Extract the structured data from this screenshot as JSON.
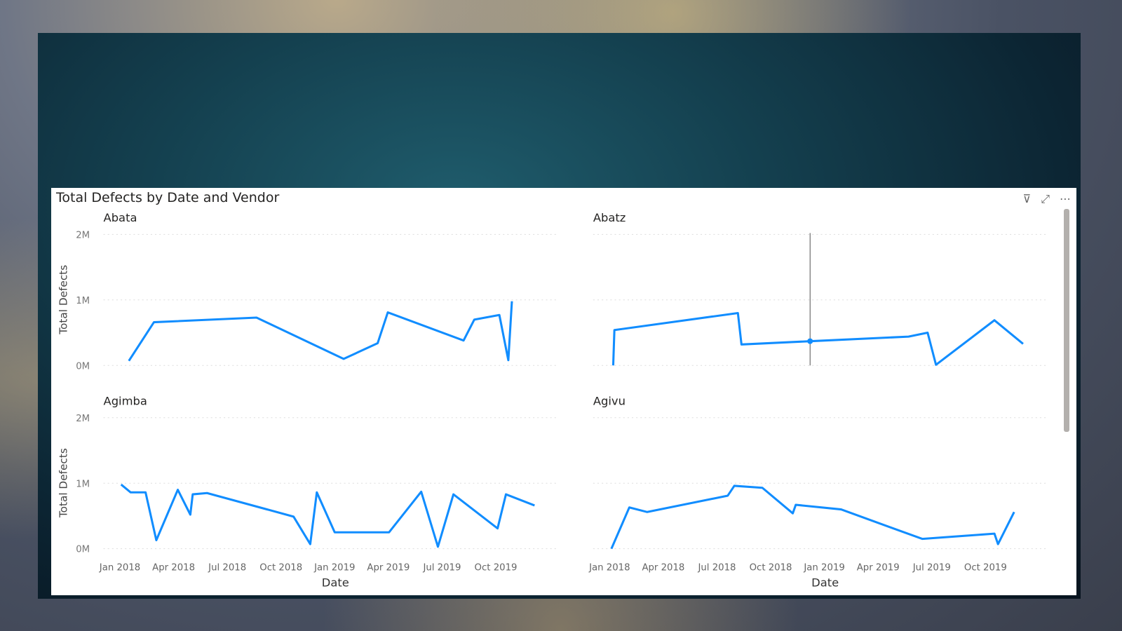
{
  "visual": {
    "title": "Total Defects by Date and Vendor",
    "icons": [
      "filter-icon",
      "focus-mode-icon",
      "more-options-icon"
    ]
  },
  "chart_data": {
    "type": "line",
    "title": "Total Defects by Date and Vendor",
    "xlabel": "Date",
    "ylabel": "Total Defects",
    "line_color": "#118DFF",
    "grid": true,
    "ylim": [
      0,
      2000000
    ],
    "y_ticks": [
      "0M",
      "1M",
      "2M"
    ],
    "x_ticks": [
      "Jan 2018",
      "Apr 2018",
      "Jul 2018",
      "Oct 2018",
      "Jan 2019",
      "Apr 2019",
      "Jul 2019",
      "Oct 2019"
    ],
    "small_multiples": [
      {
        "name": "Abata",
        "points": [
          [
            "2018-01-16",
            70000
          ],
          [
            "2018-02-28",
            660000
          ],
          [
            "2018-08-20",
            730000
          ],
          [
            "2019-01-16",
            100000
          ],
          [
            "2019-03-13",
            340000
          ],
          [
            "2019-03-30",
            810000
          ],
          [
            "2019-08-07",
            380000
          ],
          [
            "2019-08-25",
            700000
          ],
          [
            "2019-10-07",
            770000
          ],
          [
            "2019-10-22",
            80000
          ],
          [
            "2019-10-28",
            980000
          ]
        ]
      },
      {
        "name": "Abatz",
        "hover_date": "2018-12-07",
        "points": [
          [
            "2018-01-07",
            0
          ],
          [
            "2018-01-09",
            540000
          ],
          [
            "2018-08-06",
            800000
          ],
          [
            "2018-08-12",
            320000
          ],
          [
            "2018-12-07",
            370000
          ],
          [
            "2019-05-22",
            440000
          ],
          [
            "2019-06-24",
            500000
          ],
          [
            "2019-07-08",
            10000
          ],
          [
            "2019-10-16",
            690000
          ],
          [
            "2019-12-04",
            330000
          ]
        ]
      },
      {
        "name": "Agimba",
        "points": [
          [
            "2018-01-03",
            980000
          ],
          [
            "2018-01-19",
            860000
          ],
          [
            "2018-02-14",
            860000
          ],
          [
            "2018-03-02",
            130000
          ],
          [
            "2018-04-08",
            900000
          ],
          [
            "2018-04-29",
            520000
          ],
          [
            "2018-05-03",
            830000
          ],
          [
            "2018-05-27",
            850000
          ],
          [
            "2018-10-22",
            490000
          ],
          [
            "2018-11-20",
            70000
          ],
          [
            "2018-12-01",
            860000
          ],
          [
            "2019-01-01",
            250000
          ],
          [
            "2019-04-02",
            250000
          ],
          [
            "2019-05-26",
            870000
          ],
          [
            "2019-06-24",
            30000
          ],
          [
            "2019-07-20",
            830000
          ],
          [
            "2019-10-04",
            310000
          ],
          [
            "2019-10-18",
            830000
          ],
          [
            "2019-12-06",
            660000
          ]
        ]
      },
      {
        "name": "Agivu",
        "points": [
          [
            "2018-01-04",
            0
          ],
          [
            "2018-02-04",
            630000
          ],
          [
            "2018-03-04",
            560000
          ],
          [
            "2018-07-19",
            810000
          ],
          [
            "2018-07-30",
            960000
          ],
          [
            "2018-09-17",
            930000
          ],
          [
            "2018-11-08",
            540000
          ],
          [
            "2018-11-13",
            670000
          ],
          [
            "2019-01-29",
            600000
          ],
          [
            "2019-06-15",
            150000
          ],
          [
            "2019-10-16",
            230000
          ],
          [
            "2019-10-22",
            70000
          ],
          [
            "2019-11-19",
            560000
          ]
        ]
      }
    ]
  }
}
